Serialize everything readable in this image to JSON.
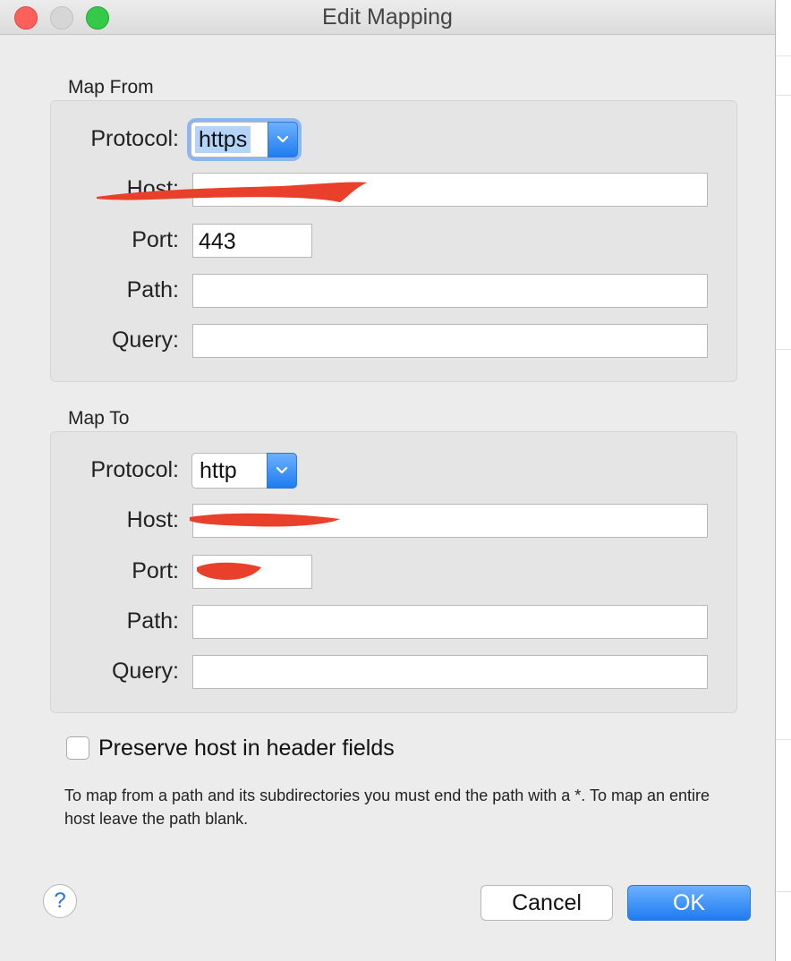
{
  "window": {
    "title": "Edit Mapping"
  },
  "map_from": {
    "group_label": "Map From",
    "protocol_label": "Protocol:",
    "protocol_value": "https",
    "host_label": "Host:",
    "host_value": "",
    "port_label": "Port:",
    "port_value": "443",
    "path_label": "Path:",
    "path_value": "",
    "query_label": "Query:",
    "query_value": ""
  },
  "map_to": {
    "group_label": "Map To",
    "protocol_label": "Protocol:",
    "protocol_value": "http",
    "host_label": "Host:",
    "host_value": "",
    "port_label": "Port:",
    "port_value": "",
    "path_label": "Path:",
    "path_value": "",
    "query_label": "Query:",
    "query_value": ""
  },
  "options": {
    "preserve_host_label": "Preserve host in header fields",
    "preserve_host_checked": false
  },
  "hint": "To map from a path and its subdirectories you must end the path with a *. To map an entire host leave the path blank.",
  "buttons": {
    "help": "?",
    "cancel": "Cancel",
    "ok": "OK"
  },
  "colors": {
    "accent": "#1f7cf0",
    "focus_ring": "#8db6f0",
    "redaction": "#e8402a"
  }
}
